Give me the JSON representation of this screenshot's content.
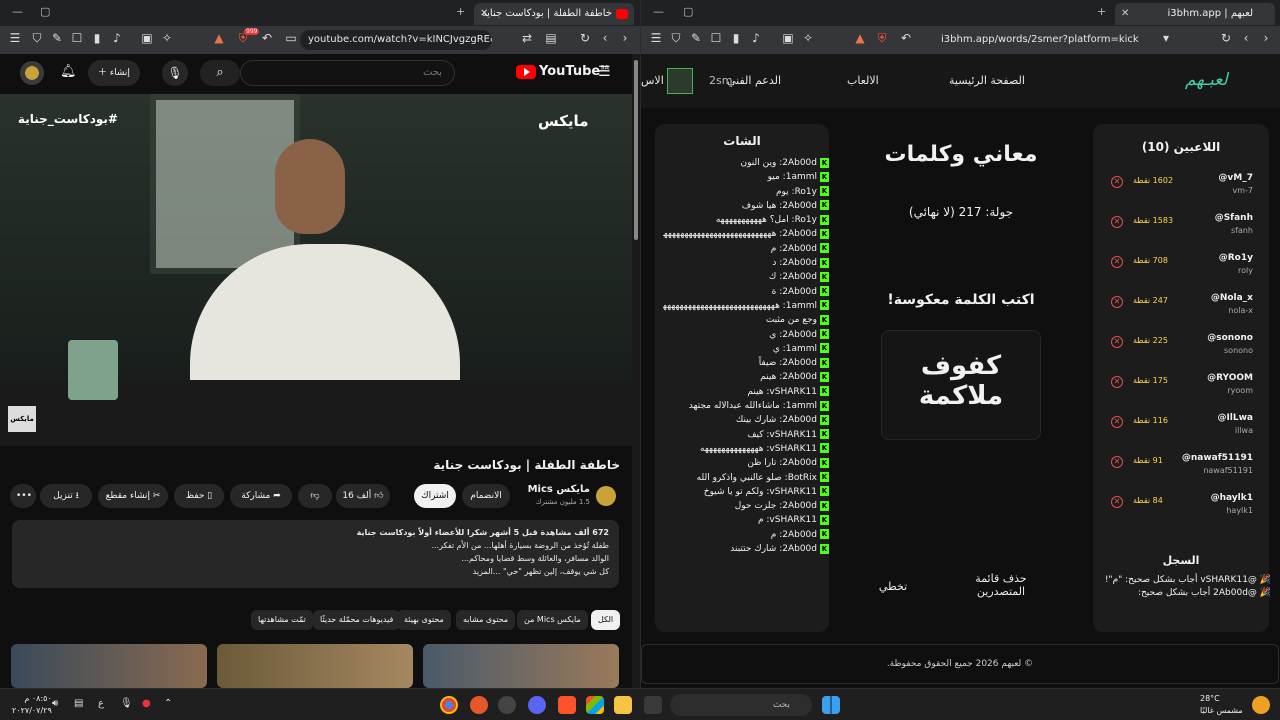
{
  "left_window": {
    "tab_title": "خاطفة الطفلة | بودكاست جناية",
    "tab2_title": "...",
    "url": "youtube.com/watch?v=kINCJvgzgRE&t=1...",
    "notif_count": "999",
    "youtube": {
      "search_placeholder": "بحث",
      "create_label": "إنشاء",
      "logo_text": "YouTube",
      "logo_region": "SA",
      "video": {
        "hashtag": "#بودكاست_جناية",
        "brand": "مايكس",
        "watermark": "مايكس"
      },
      "title": "خاطفة الطفلة | بودكاست جناية",
      "channel": "مايكس Mics",
      "subscribers": "1.5 مليون مشترك",
      "join_label": "الانضمام",
      "subscribe_label": "اشتراك",
      "likes": "16 ألف",
      "share_label": "مشاركة",
      "save_label": "حفظ",
      "clip_label": "إنشاء مقطع",
      "download_label": "تنزيل",
      "description": {
        "line1": "672 ألف مشاهدة  قبل 5 أشهر  شكرا للأعضاء أولاً  بودكاست جناية",
        "line2": "طفلة تُؤخذ من الروضة بسيارة أهلها... من الأم تفكر...",
        "line3": "الوالد مسافر، والعائلة وسط قضايا ومحاكم...",
        "line4": "كل شي يوقف، إلين تظهر \"حي\" ...المزيد"
      },
      "chips": [
        "الكل",
        "من Mics مايكس",
        "محتوى مشابه",
        "محتوى بهيئة",
        "فيديوهات محمّلة حديثًا",
        "تمّت مشاهدتها"
      ]
    }
  },
  "right_window": {
    "tab_title": "لعبهم | i3bhm.app",
    "url": "i3bhm.app/words/2smer?platform=kick",
    "nav": {
      "logo": "لعبـهم",
      "home": "الصفحة الرئيسية",
      "games": "الالعاب",
      "support": "الدعم الفني",
      "user": "2sm",
      "cut": "الاس"
    },
    "chat": {
      "title": "الشات",
      "messages": [
        "2Ab00d: وين النون",
        "1amml: ميو",
        "Ro1y: يوم",
        "2Ab00d: هيا شوف",
        "Ro1y: امل؟ هههههههههههه",
        "2Ab00d: ههههههههههههههههههههههههههههههههههه",
        "2Ab00d: م",
        "2Ab00d: د",
        "2Ab00d: ك",
        "2Ab00d: ة",
        "1amml: ههههههههههههههههههههههههههههههههههه",
        "وجع من مثبت",
        "2Ab00d: ي",
        "1amml: ي",
        "2Ab00d: ضيفاً",
        "2Ab00d: هينم",
        "vSHARK11: هينم",
        "1amml: ماشاءالله عبدالاله مجتهد",
        "2Ab00d: شارك بينك",
        "vSHARK11: كيف",
        "vSHARK11: ههههههههههههههه",
        "2Ab00d: تارا ظن",
        "BotRix: صلو عالنبي واذكرو الله",
        "vSHARK11: ولكم تو يا شيوخ",
        "2Ab00d: جلزت حول",
        "vSHARK11: م",
        "2Ab00d: م",
        "2Ab00d: شارك حتتبند"
      ]
    },
    "game": {
      "title": "معاني وكلمات",
      "round": "جولة: 217 (لا نهائي)",
      "prompt": "اكتب الكلمة معكوسة!",
      "word_line1": "كفوف",
      "word_line2": "ملاكمة",
      "skip_label": "تخطي",
      "clear_label": "حذف قائمة المتصدرين"
    },
    "players": {
      "title": "اللاعبين (10)",
      "list": [
        {
          "name": "@vM_7",
          "user": "vm-7",
          "points": "1602 نقطة"
        },
        {
          "name": "@Sfanh",
          "user": "sfanh",
          "points": "1583 نقطة"
        },
        {
          "name": "@Ro1y",
          "user": "roly",
          "points": "708 نقطة"
        },
        {
          "name": "@Nola_x",
          "user": "nola-x",
          "points": "247 نقطة"
        },
        {
          "name": "@sonono",
          "user": "sonono",
          "points": "225 نقطة"
        },
        {
          "name": "@RYOOM",
          "user": "ryoom",
          "points": "175 نقطة"
        },
        {
          "name": "@IlLwa",
          "user": "illwa",
          "points": "116 نقطة"
        },
        {
          "name": "@nawaf51191",
          "user": "nawaf51191",
          "points": "91 نقطة"
        },
        {
          "name": "@haylk1",
          "user": "haylk1",
          "points": "84 نقطة"
        }
      ],
      "log_title": "السجل",
      "log": [
        "🎉 @vSHARK11 أجاب بشكل صحيح: \"م\"!",
        "🎉 @2Ab00d أجاب بشكل صحيح:"
      ]
    },
    "footer": "© لعبهم 2026 جميع الحقوق محفوظة."
  },
  "taskbar": {
    "search_label": "بحث",
    "time": "٠٨:٥٠ م",
    "date": "٢٠٢٧/٠٧/٢٩",
    "temperature": "28°C",
    "weather": "مشمس غالبًا",
    "lang": "ع"
  },
  "colors": {
    "kick_green": "#53fc18",
    "youtube_red": "#ff0000",
    "site_accent": "#3fd2a8",
    "points_gold": "#ffd54f"
  }
}
